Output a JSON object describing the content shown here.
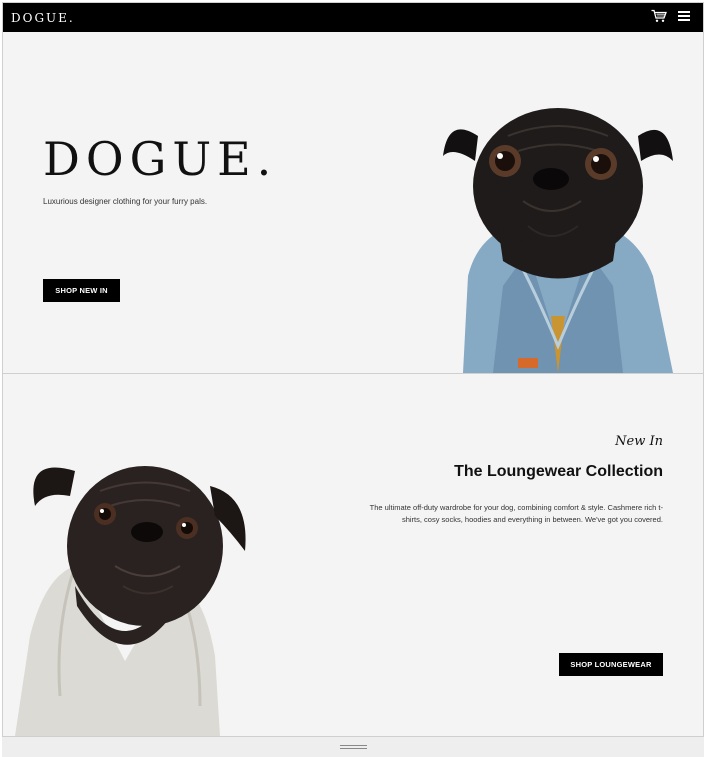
{
  "navbar": {
    "brand": "DOGUE.",
    "icons": [
      "cart-icon",
      "menu-icon"
    ]
  },
  "hero": {
    "title": "DOGUE.",
    "tagline": "Luxurious designer clothing for your furry pals.",
    "button_label": "SHOP NEW IN"
  },
  "loungewear": {
    "kicker": "New In",
    "title": "The Loungewear Collection",
    "description": "The ultimate off-duty wardrobe for your dog, combining comfort & style. Cashmere rich t-shirts, cosy socks, hoodies and everything in between. We've got you covered.",
    "button_label": "SHOP LOUNGEWEAR"
  },
  "colors": {
    "navbar_bg": "#000000",
    "page_bg": "#f4f4f4",
    "button_bg": "#000000",
    "button_text": "#ffffff"
  }
}
